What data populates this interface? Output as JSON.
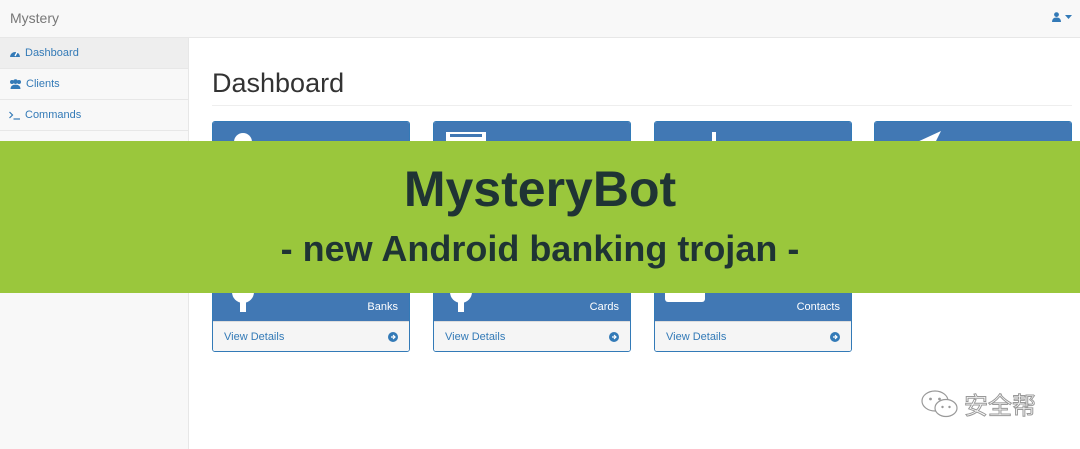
{
  "navbar": {
    "brand": "Mystery",
    "user_icon": "user-icon"
  },
  "sidebar": {
    "items": [
      {
        "label": "Dashboard",
        "icon": "dashboard-icon",
        "active": true
      },
      {
        "label": "Clients",
        "icon": "users-icon",
        "active": false
      },
      {
        "label": "Commands",
        "icon": "terminal-icon",
        "active": false
      }
    ]
  },
  "main": {
    "title": "Dashboard",
    "panels": [
      {
        "label": "Banks",
        "link": "View Details",
        "icon": "bank-icon"
      },
      {
        "label": "Cards",
        "link": "View Details",
        "icon": "card-icon"
      },
      {
        "label": "Contacts",
        "link": "View Details",
        "icon": "contacts-icon"
      },
      {
        "label": "",
        "link": "",
        "icon": "send-icon"
      }
    ]
  },
  "banner": {
    "title": "MysteryBot",
    "subtitle": "- new Android banking trojan -",
    "color": "#9ac73c"
  },
  "watermark": {
    "text": "安全帮",
    "icon": "wechat-icon"
  }
}
